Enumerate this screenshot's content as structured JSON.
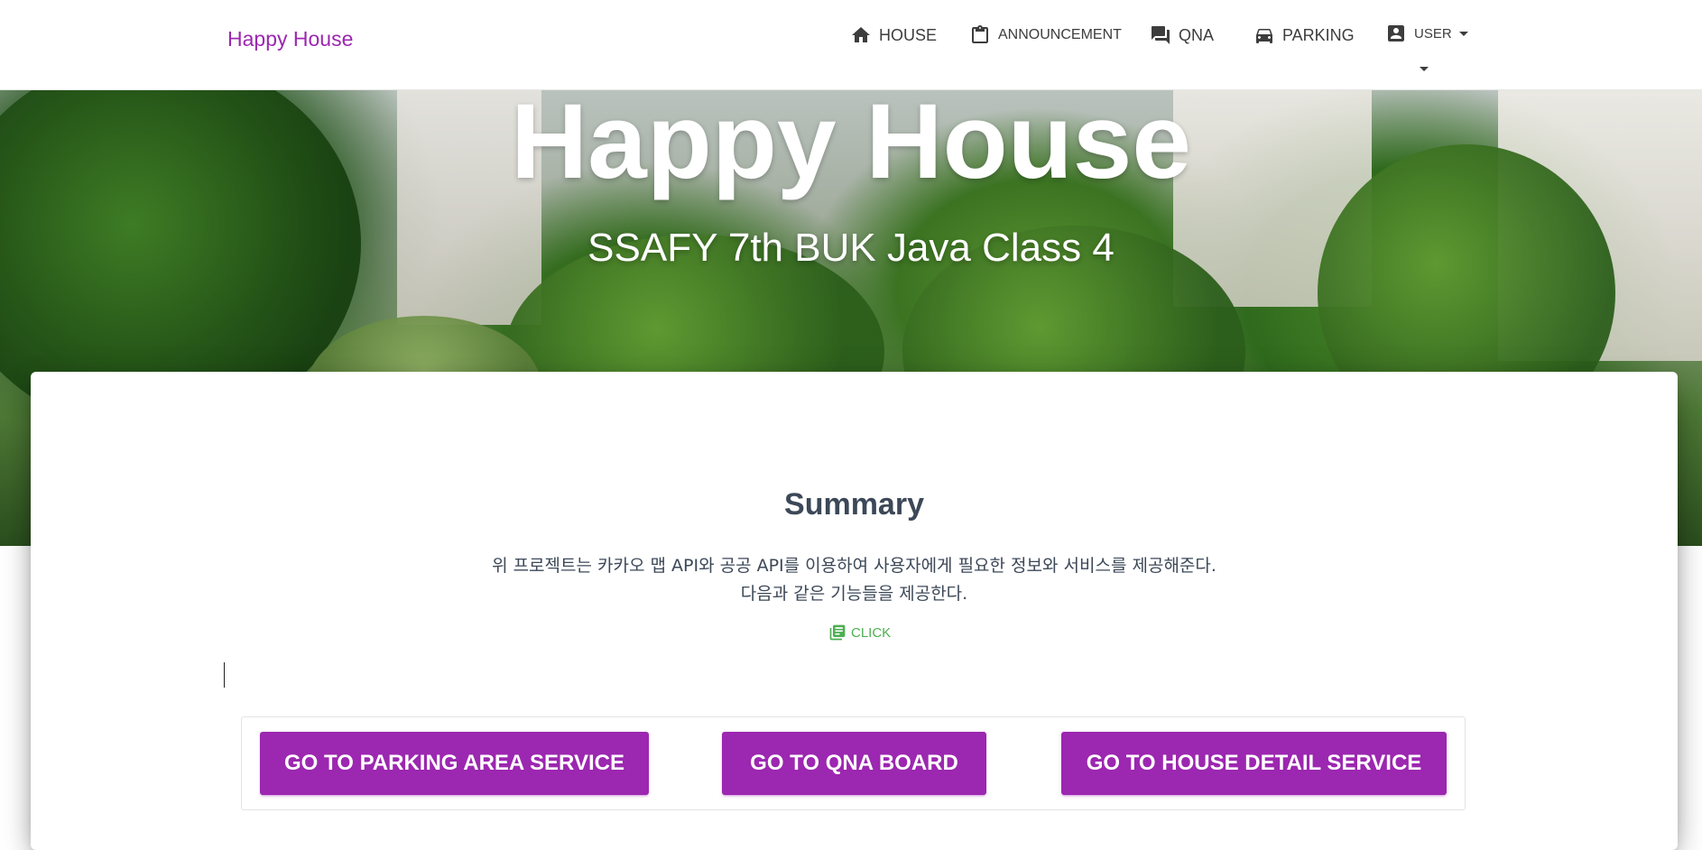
{
  "navbar": {
    "brand": "Happy House",
    "items": [
      {
        "label": "HOUSE",
        "icon": "home-icon"
      },
      {
        "label": "ANNOUNCEMENT",
        "icon": "clipboard-icon"
      },
      {
        "label": "QNA",
        "icon": "forum-icon"
      },
      {
        "label": "PARKING",
        "icon": "car-icon"
      },
      {
        "label": "USER",
        "icon": "account-box-icon"
      }
    ]
  },
  "hero": {
    "title": "Happy House",
    "subtitle": "SSAFY 7th BUK Java Class 4"
  },
  "summary": {
    "title": "Summary",
    "line1": "위 프로젝트는 카카오 맵 API와 공공 API를 이용하여 사용자에게 필요한 정보와 서비스를 제공해준다.",
    "line2": "다음과 같은 기능들을 제공한다.",
    "click_label": "CLICK"
  },
  "buttons": {
    "parking": "GO TO PARKING AREA SERVICE",
    "qna": "GO TO QNA BOARD",
    "house": "GO TO HOUSE DETAIL SERVICE"
  },
  "colors": {
    "brand": "#9c27b0",
    "link_green": "#4caf50",
    "title_text": "#3c4858"
  }
}
